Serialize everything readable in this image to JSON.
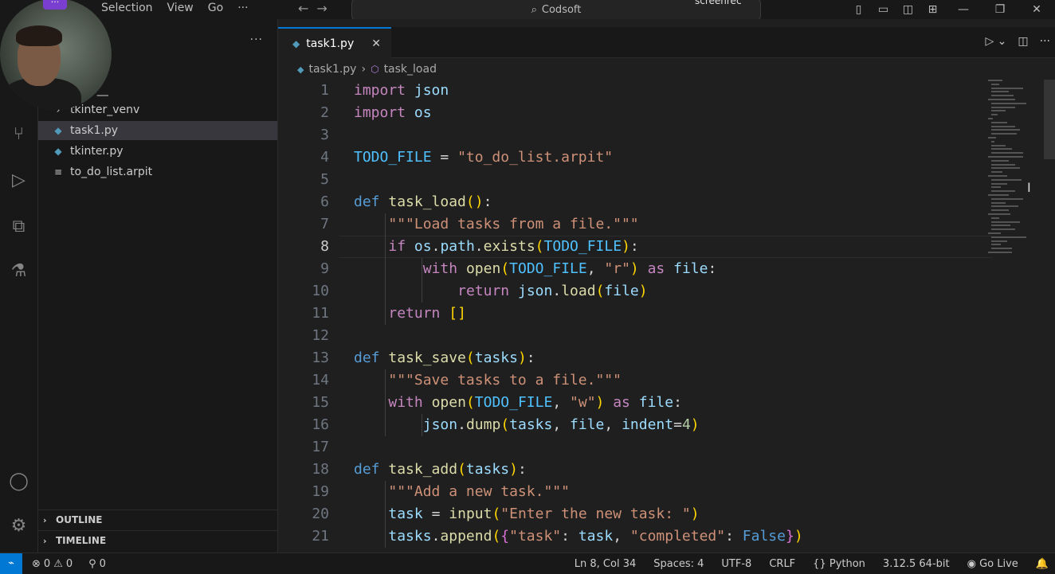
{
  "window": {
    "menu": [
      "Selection",
      "View",
      "Go",
      "···"
    ],
    "search_text": "Codsoft",
    "recorder_label": "screenrec",
    "brand_badge": "···"
  },
  "sidebar": {
    "more": "···",
    "items": [
      {
        "label": "__pycache__",
        "visible_label": "ache__",
        "icon": "chevron-right-icon",
        "selected": false
      },
      {
        "label": "tkinter_venv",
        "icon": "chevron-right-icon",
        "selected": false
      },
      {
        "label": "task1.py",
        "icon": "python-file-icon",
        "selected": true
      },
      {
        "label": "tkinter.py",
        "icon": "python-file-icon",
        "selected": false
      },
      {
        "label": "to_do_list.arpit",
        "icon": "text-file-icon",
        "selected": false
      }
    ],
    "sections": [
      "OUTLINE",
      "TIMELINE"
    ]
  },
  "editor": {
    "tab": {
      "label": "task1.py",
      "close": "✕"
    },
    "breadcrumbs": [
      "task1.py",
      "task_load"
    ],
    "current_line": 8,
    "lines": [
      {
        "n": "1",
        "text": "import json"
      },
      {
        "n": "2",
        "text": "import os"
      },
      {
        "n": "3",
        "text": ""
      },
      {
        "n": "4",
        "text": "TODO_FILE = \"to_do_list.arpit\""
      },
      {
        "n": "5",
        "text": ""
      },
      {
        "n": "6",
        "text": "def task_load():"
      },
      {
        "n": "7",
        "text": "    \"\"\"Load tasks from a file.\"\"\""
      },
      {
        "n": "8",
        "text": "    if os.path.exists(TODO_FILE):"
      },
      {
        "n": "9",
        "text": "        with open(TODO_FILE, \"r\") as file:"
      },
      {
        "n": "10",
        "text": "            return json.load(file)"
      },
      {
        "n": "11",
        "text": "    return []"
      },
      {
        "n": "12",
        "text": ""
      },
      {
        "n": "13",
        "text": "def task_save(tasks):"
      },
      {
        "n": "14",
        "text": "    \"\"\"Save tasks to a file.\"\"\""
      },
      {
        "n": "15",
        "text": "    with open(TODO_FILE, \"w\") as file:"
      },
      {
        "n": "16",
        "text": "        json.dump(tasks, file, indent=4)"
      },
      {
        "n": "17",
        "text": ""
      },
      {
        "n": "18",
        "text": "def task_add(tasks):"
      },
      {
        "n": "19",
        "text": "    \"\"\"Add a new task.\"\"\""
      },
      {
        "n": "20",
        "text": "    task = input(\"Enter the new task: \")"
      },
      {
        "n": "21",
        "text": "    tasks.append({\"task\": task, \"completed\": False})"
      }
    ]
  },
  "status": {
    "errors": "0",
    "warnings": "0",
    "ports": "0",
    "position": "Ln 8, Col 34",
    "spaces": "Spaces: 4",
    "encoding": "UTF-8",
    "eol": "CRLF",
    "language": "Python",
    "interpreter": "3.12.5 64-bit",
    "golive": "Go Live"
  },
  "colors": {
    "accent": "#0078d4",
    "editor_bg": "#1f1f1f",
    "sidebar_bg": "#181818",
    "keyword": "#c586c0",
    "function": "#dcdcaa",
    "string": "#ce9178"
  }
}
